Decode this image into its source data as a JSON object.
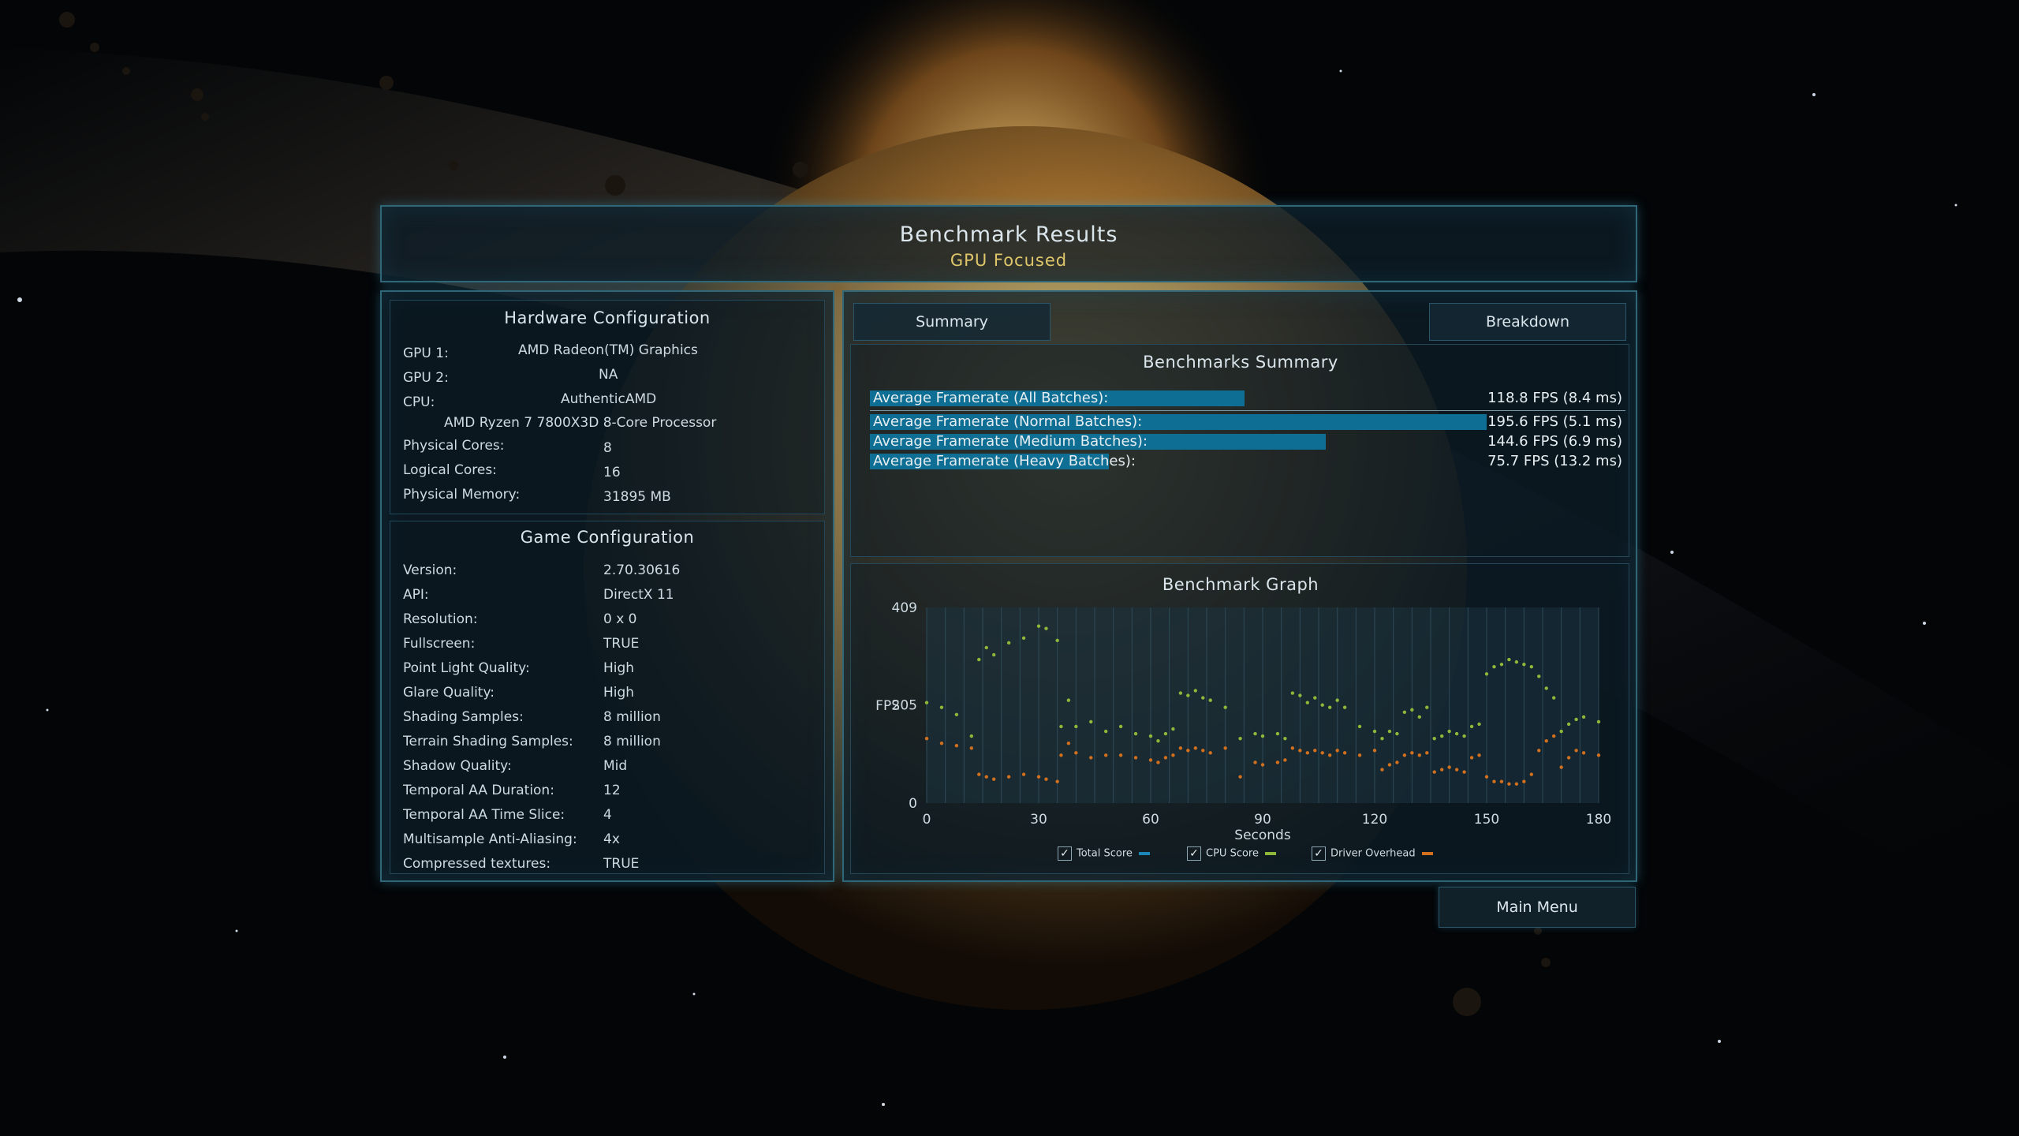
{
  "header": {
    "title": "Benchmark Results",
    "subtitle": "GPU Focused"
  },
  "hardware": {
    "title": "Hardware Configuration",
    "gpu1_label": "GPU 1:",
    "gpu1_value": "AMD Radeon(TM) Graphics",
    "gpu2_label": "GPU 2:",
    "gpu2_value": "NA",
    "cpu_label": "CPU:",
    "cpu_value": "AuthenticAMD",
    "cpu_model": "AMD Ryzen 7 7800X3D 8-Core Processor",
    "physical_cores_label": "Physical Cores:",
    "physical_cores_value": "8",
    "logical_cores_label": "Logical Cores:",
    "logical_cores_value": "16",
    "memory_label": "Physical Memory:",
    "memory_value": "31895  MB"
  },
  "game": {
    "title": "Game Configuration",
    "rows": [
      {
        "label": "Version:",
        "value": "2.70.30616"
      },
      {
        "label": "API:",
        "value": "DirectX 11"
      },
      {
        "label": "Resolution:",
        "value": "0 x 0"
      },
      {
        "label": "Fullscreen:",
        "value": "TRUE"
      },
      {
        "label": "Point Light Quality:",
        "value": "High"
      },
      {
        "label": "Glare Quality:",
        "value": "High"
      },
      {
        "label": "Shading Samples:",
        "value": "8 million"
      },
      {
        "label": "Terrain Shading Samples:",
        "value": "8 million"
      },
      {
        "label": "Shadow Quality:",
        "value": "Mid"
      },
      {
        "label": "Temporal AA Duration:",
        "value": "12"
      },
      {
        "label": "Temporal AA Time Slice:",
        "value": "4"
      },
      {
        "label": "Multisample Anti-Aliasing:",
        "value": "4x"
      },
      {
        "label": "Compressed textures:",
        "value": "TRUE"
      }
    ]
  },
  "tabs": {
    "summary": "Summary",
    "breakdown": "Breakdown"
  },
  "summary": {
    "title": "Benchmarks Summary",
    "rows": [
      {
        "label": "Average Framerate (All Batches):",
        "value": "118.8 FPS (8.4 ms)",
        "fps": 118.8
      },
      {
        "label": "Average Framerate (Normal Batches):",
        "value": "195.6 FPS (5.1 ms)",
        "fps": 195.6
      },
      {
        "label": "Average Framerate (Medium Batches):",
        "value": "144.6 FPS (6.9 ms)",
        "fps": 144.6
      },
      {
        "label": "Average Framerate (Heavy Batches):",
        "value": "75.7 FPS (13.2 ms)",
        "fps": 75.7
      }
    ]
  },
  "graph_title": "Benchmark Graph",
  "chart_data": {
    "type": "scatter",
    "title": "Benchmark Graph",
    "xlabel": "Seconds",
    "ylabel": "FPS",
    "xlim": [
      0,
      180
    ],
    "ylim": [
      0,
      409
    ],
    "xticks": [
      "0",
      "30",
      "60",
      "90",
      "120",
      "150",
      "180"
    ],
    "yticks": [
      "0",
      "205",
      "409"
    ],
    "grid": true,
    "legend": "bottom",
    "series": [
      {
        "name": "Total Score",
        "color": "#1d86b8",
        "visible": true,
        "x": [],
        "y": []
      },
      {
        "name": "CPU Score",
        "color": "#8fb83a",
        "visible": true,
        "x": [
          0,
          4,
          8,
          12,
          14,
          16,
          18,
          22,
          26,
          30,
          32,
          35,
          36,
          38,
          40,
          44,
          48,
          52,
          56,
          60,
          62,
          64,
          66,
          68,
          70,
          72,
          74,
          76,
          80,
          84,
          88,
          90,
          94,
          96,
          98,
          100,
          102,
          104,
          106,
          108,
          110,
          112,
          116,
          120,
          122,
          124,
          126,
          128,
          130,
          132,
          134,
          136,
          138,
          140,
          142,
          144,
          146,
          148,
          150,
          152,
          154,
          156,
          158,
          160,
          162,
          164,
          166,
          168,
          170,
          172,
          174,
          176,
          180
        ],
        "y": [
          210,
          200,
          185,
          140,
          300,
          325,
          310,
          335,
          345,
          370,
          365,
          340,
          160,
          215,
          160,
          170,
          150,
          160,
          145,
          140,
          130,
          145,
          155,
          230,
          225,
          235,
          220,
          215,
          200,
          135,
          145,
          140,
          145,
          135,
          230,
          225,
          210,
          220,
          205,
          200,
          215,
          200,
          160,
          150,
          135,
          150,
          145,
          190,
          195,
          180,
          200,
          135,
          140,
          150,
          145,
          140,
          160,
          165,
          270,
          285,
          290,
          300,
          295,
          290,
          285,
          265,
          240,
          220,
          150,
          165,
          175,
          180,
          170
        ]
      },
      {
        "name": "Driver Overhead",
        "color": "#d2701e",
        "visible": true,
        "x": [
          0,
          4,
          8,
          12,
          14,
          16,
          18,
          22,
          26,
          30,
          32,
          35,
          36,
          38,
          40,
          44,
          48,
          52,
          56,
          60,
          62,
          64,
          66,
          68,
          70,
          72,
          74,
          76,
          80,
          84,
          88,
          90,
          94,
          96,
          98,
          100,
          102,
          104,
          106,
          108,
          110,
          112,
          116,
          120,
          122,
          124,
          126,
          128,
          130,
          132,
          134,
          136,
          138,
          140,
          142,
          144,
          146,
          148,
          150,
          152,
          154,
          156,
          158,
          160,
          162,
          164,
          166,
          168,
          170,
          172,
          174,
          176,
          180
        ],
        "y": [
          135,
          125,
          120,
          115,
          60,
          55,
          50,
          55,
          60,
          55,
          50,
          45,
          100,
          125,
          105,
          95,
          100,
          100,
          95,
          90,
          85,
          95,
          100,
          115,
          110,
          115,
          110,
          105,
          115,
          55,
          85,
          80,
          85,
          90,
          115,
          110,
          105,
          110,
          105,
          100,
          110,
          105,
          100,
          110,
          70,
          80,
          85,
          100,
          105,
          100,
          105,
          65,
          70,
          75,
          70,
          65,
          95,
          100,
          55,
          45,
          45,
          40,
          40,
          45,
          60,
          110,
          130,
          140,
          75,
          95,
          110,
          105,
          100
        ]
      }
    ]
  },
  "legend": {
    "total_score": "Total Score",
    "cpu_score": "CPU Score",
    "driver_overhead": "Driver Overhead",
    "check_glyph": "✓"
  },
  "main_menu_label": "Main Menu",
  "colors": {
    "accent": "#0f6e93",
    "subtitle": "#e0c66a",
    "frame": "#2f6678"
  }
}
